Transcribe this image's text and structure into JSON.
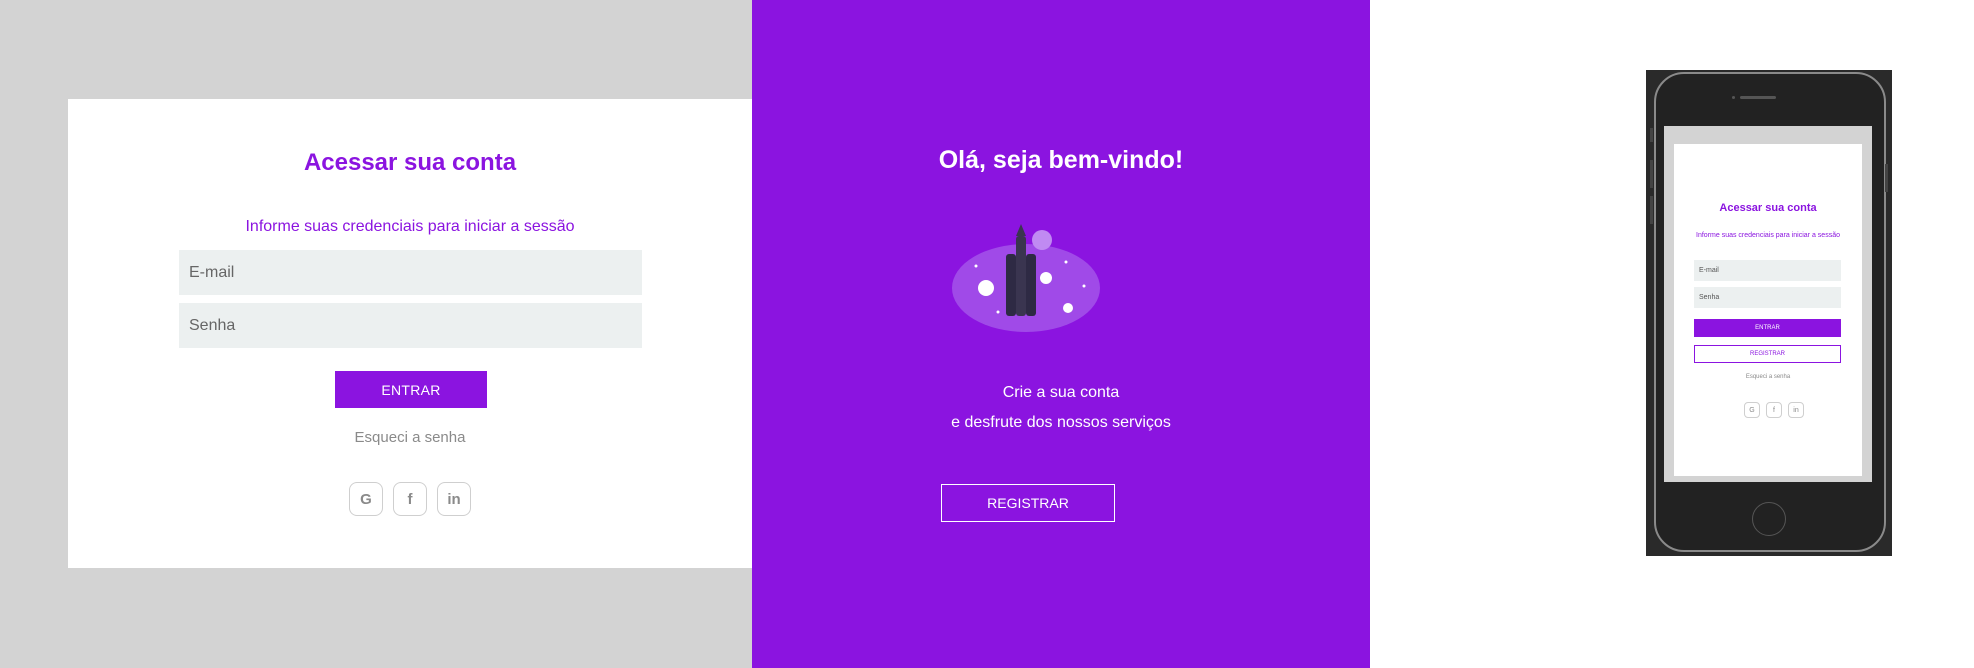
{
  "login": {
    "title": "Acessar sua conta",
    "subtitle": "Informe suas credenciais para iniciar a sessão",
    "email_placeholder": "E-mail",
    "password_placeholder": "Senha",
    "enter_label": "ENTRAR",
    "forgot_label": "Esqueci a senha",
    "socials": [
      {
        "icon": "google-icon",
        "glyph": "G"
      },
      {
        "icon": "facebook-icon",
        "glyph": "f"
      },
      {
        "icon": "linkedin-icon",
        "glyph": "in"
      }
    ]
  },
  "welcome": {
    "title": "Olá, seja bem-vindo!",
    "line1": "Crie a sua conta",
    "line2": "e desfrute dos nossos serviços",
    "register_label": "REGISTRAR"
  },
  "mobile": {
    "title": "Acessar sua conta",
    "subtitle": "Informe suas credenciais para iniciar a sessão",
    "email_placeholder": "E-mail",
    "password_placeholder": "Senha",
    "enter_label": "ENTRAR",
    "register_label": "REGISTRAR",
    "forgot_label": "Esqueci a senha",
    "socials": [
      "G",
      "f",
      "in"
    ]
  },
  "colors": {
    "brand_purple": "#8b14e0",
    "field_bg": "#ecf0f0",
    "page_grey": "#d3d3d3"
  }
}
